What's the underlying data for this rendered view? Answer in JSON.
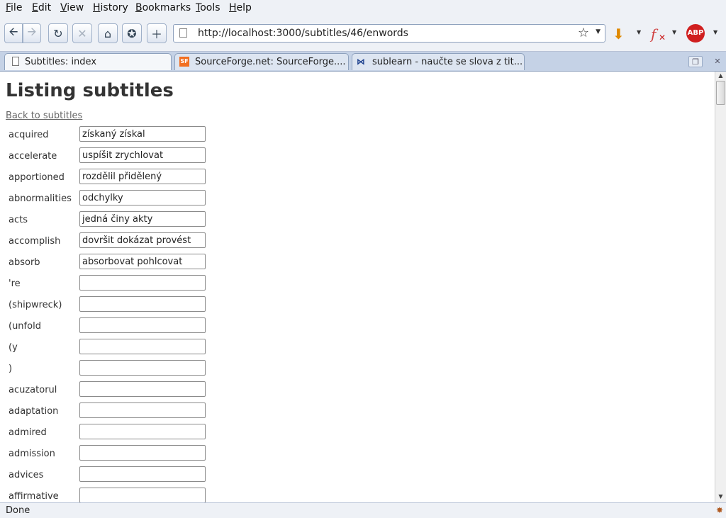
{
  "menu": [
    "File",
    "Edit",
    "View",
    "History",
    "Bookmarks",
    "Tools",
    "Help"
  ],
  "nav": {
    "back_icon": "back-arrow-icon",
    "forward_icon": "forward-arrow-icon",
    "reload_icon": "reload-icon",
    "stop_icon": "stop-icon",
    "home_icon": "home-icon",
    "url": "http://localhost:3000/subtitles/46/enwords"
  },
  "tabs": [
    {
      "title": "Subtitles: index",
      "active": true
    },
    {
      "title": "SourceForge.net: SourceForge....",
      "active": false
    },
    {
      "title": "sublearn - naučte se slova z tit...",
      "active": false
    }
  ],
  "page": {
    "heading": "Listing subtitles",
    "back_link": "Back to subtitles",
    "words": [
      {
        "en": "acquired",
        "cs": "získaný získal"
      },
      {
        "en": "accelerate",
        "cs": "uspíšit zrychlovat"
      },
      {
        "en": "apportioned",
        "cs": "rozdělil přidělený"
      },
      {
        "en": "abnormalities",
        "cs": "odchylky"
      },
      {
        "en": "acts",
        "cs": "jedná činy akty"
      },
      {
        "en": "accomplish",
        "cs": "dovršit dokázat provést"
      },
      {
        "en": "absorb",
        "cs": "absorbovat pohlcovat"
      },
      {
        "en": "'re",
        "cs": ""
      },
      {
        "en": "(shipwreck)",
        "cs": ""
      },
      {
        "en": "(unfold",
        "cs": ""
      },
      {
        "en": "(y",
        "cs": ""
      },
      {
        "en": ")",
        "cs": ""
      },
      {
        "en": "acuzatorul",
        "cs": ""
      },
      {
        "en": "adaptation",
        "cs": ""
      },
      {
        "en": "admired",
        "cs": ""
      },
      {
        "en": "admission",
        "cs": ""
      },
      {
        "en": "advices",
        "cs": ""
      },
      {
        "en": "affirmative",
        "cs": ""
      }
    ]
  },
  "status": "Done"
}
